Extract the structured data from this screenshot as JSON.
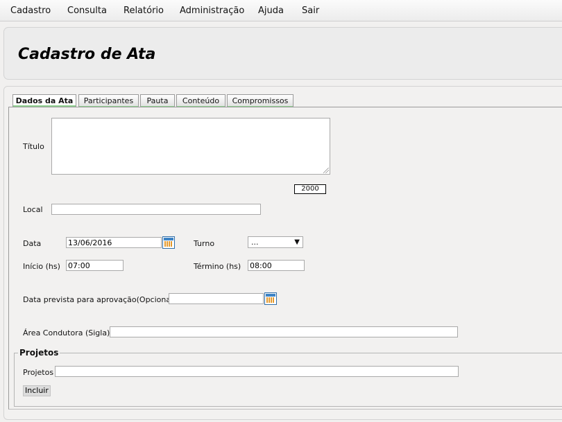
{
  "menu": [
    {
      "label": "Cadastro"
    },
    {
      "label": "Consulta"
    },
    {
      "label": "Relatório"
    },
    {
      "label": "Administração"
    },
    {
      "label": "Ajuda"
    },
    {
      "label": "Sair"
    }
  ],
  "page": {
    "title": "Cadastro de Ata"
  },
  "tabs": [
    {
      "label": "Dados da Ata",
      "active": true
    },
    {
      "label": "Participantes",
      "active": false
    },
    {
      "label": "Pauta",
      "active": false
    },
    {
      "label": "Conteúdo",
      "active": false
    },
    {
      "label": "Compromissos",
      "active": false
    }
  ],
  "form": {
    "titulo": {
      "label": "Título",
      "value": "",
      "counter": "2000"
    },
    "local": {
      "label": "Local",
      "value": ""
    },
    "data": {
      "label": "Data",
      "value": "13/06/2016"
    },
    "turno": {
      "label": "Turno",
      "value": "..."
    },
    "inicio": {
      "label": "Início (hs)",
      "value": "07:00"
    },
    "termino": {
      "label": "Término (hs)",
      "value": "08:00"
    },
    "data_prevista": {
      "label": "Data prevista para aprovação(Opcional)",
      "value": ""
    },
    "area": {
      "label": "Área Condutora (Sigla)",
      "value": ""
    }
  },
  "projetos": {
    "legend": "Projetos",
    "label": "Projetos",
    "value": "",
    "button": "Incluir"
  },
  "icons": {
    "calendar": "calendar-icon",
    "dropdown": "chevron-down-icon"
  },
  "colors": {
    "tab_accent": "#8fd08f",
    "calendar_blue": "#3c83c5"
  }
}
